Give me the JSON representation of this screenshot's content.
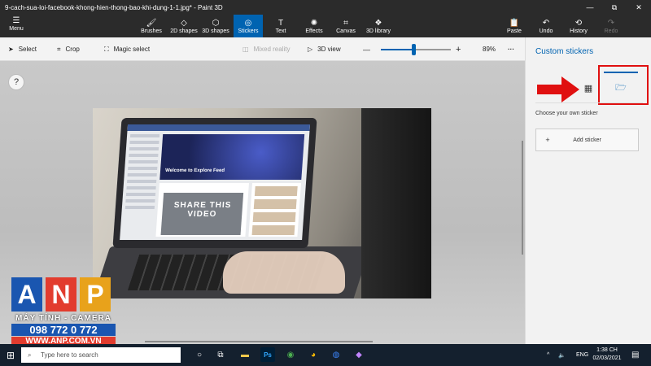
{
  "window": {
    "title": "9-cach-sua-loi-facebook-khong-hien-thong-bao-khi-dung-1-1.jpg* - Paint 3D",
    "minimize": "—",
    "maximize": "⧉",
    "close": "✕"
  },
  "ribbon": {
    "menu_label": "Menu",
    "tools": [
      {
        "label": "Brushes",
        "icon": "brush-icon",
        "glyph": "🖌"
      },
      {
        "label": "2D shapes",
        "icon": "2d-shapes-icon",
        "glyph": "◇"
      },
      {
        "label": "3D shapes",
        "icon": "3d-shapes-icon",
        "glyph": "⬡"
      },
      {
        "label": "Stickers",
        "icon": "stickers-icon",
        "glyph": "◎"
      },
      {
        "label": "Text",
        "icon": "text-icon",
        "glyph": "T"
      },
      {
        "label": "Effects",
        "icon": "effects-icon",
        "glyph": "✺"
      },
      {
        "label": "Canvas",
        "icon": "canvas-icon",
        "glyph": "⌗"
      },
      {
        "label": "3D library",
        "icon": "3d-library-icon",
        "glyph": "❖"
      }
    ],
    "active_tool": "Stickers",
    "right": [
      {
        "label": "Paste",
        "icon": "paste-icon",
        "glyph": "📋"
      },
      {
        "label": "Undo",
        "icon": "undo-icon",
        "glyph": "↶"
      },
      {
        "label": "History",
        "icon": "history-icon",
        "glyph": "⟲"
      },
      {
        "label": "Redo",
        "icon": "redo-icon",
        "glyph": "↷"
      }
    ]
  },
  "toolbar": {
    "select": "Select",
    "crop": "Crop",
    "magic_select": "Magic select",
    "mixed_reality": "Mixed reality",
    "view_3d": "3D view",
    "zoom_minus": "—",
    "zoom_plus": "+",
    "zoom_value": "89%",
    "zoom_fraction": 0.47,
    "more": "···"
  },
  "canvas": {
    "help": "?",
    "photo": {
      "hero_text": "Welcome to Explore Feed",
      "video_text": "SHARE THIS VIDEO"
    }
  },
  "watermark": {
    "letters": [
      "A",
      "N",
      "P"
    ],
    "letter_colors": [
      "#1a56b0",
      "#e23c2e",
      "#e8a21b"
    ],
    "subtitle": "MÁY TÍNH - CAMERA",
    "phone": "098 772 0 772",
    "website": "WWW.ANP.COM.VN"
  },
  "panel": {
    "title": "Custom stickers",
    "choose_label": "Choose your own sticker",
    "add_sticker": "Add sticker",
    "add_plus": "+"
  },
  "taskbar": {
    "search_placeholder": "Type here to search",
    "language": "ENG",
    "time": "1:38 CH",
    "date": "02/03/2021",
    "tray_caret": "^"
  },
  "colors": {
    "accent": "#0063b1",
    "highlight": "#e01010"
  }
}
